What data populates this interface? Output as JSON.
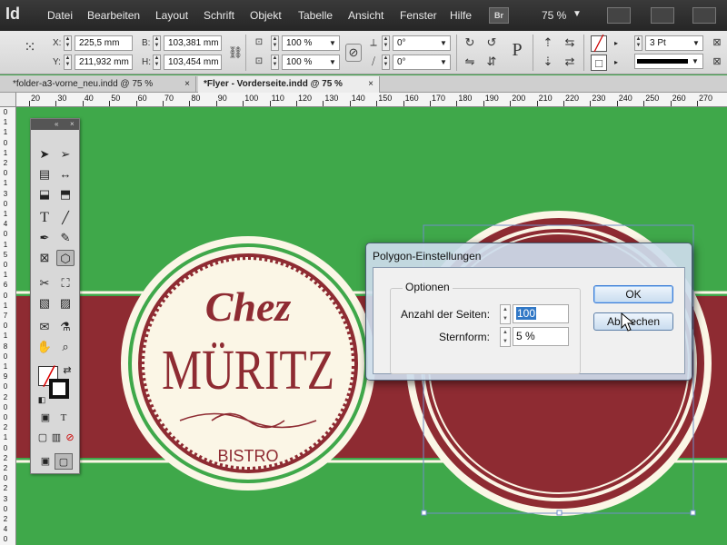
{
  "app": {
    "logo": "Id"
  },
  "menu": [
    "Datei",
    "Bearbeiten",
    "Layout",
    "Schrift",
    "Objekt",
    "Tabelle",
    "Ansicht",
    "Fenster",
    "Hilfe"
  ],
  "menu_extra": {
    "bridge": "Br",
    "zoom": "75 %"
  },
  "control": {
    "x_label": "X:",
    "x_value": "225,5 mm",
    "y_label": "Y:",
    "y_value": "211,932 mm",
    "b_label": "B:",
    "b_value": "103,381 mm",
    "h_label": "H:",
    "h_value": "103,454 mm",
    "scale_x": "100 %",
    "scale_y": "100 %",
    "rotate": "0°",
    "shear": "0°",
    "stroke_weight": "3 Pt"
  },
  "tabs": [
    {
      "label": "*folder-a3-vorne_neu.indd @ 75 %"
    },
    {
      "label": "*Flyer - Vorderseite.indd @ 75 %"
    }
  ],
  "ruler_h": [
    "20",
    "30",
    "40",
    "50",
    "60",
    "70",
    "80",
    "90",
    "100",
    "110",
    "120",
    "130",
    "140",
    "150",
    "160",
    "170",
    "180",
    "190",
    "200",
    "210",
    "220",
    "230",
    "240",
    "250",
    "260",
    "270"
  ],
  "ruler_v": [
    "0",
    "1",
    "1",
    "0",
    "1",
    "2",
    "0",
    "1",
    "3",
    "0",
    "1",
    "4",
    "0",
    "1",
    "5",
    "0",
    "1",
    "6",
    "0",
    "1",
    "7",
    "0",
    "1",
    "8",
    "0",
    "1",
    "9",
    "0",
    "2",
    "0",
    "0",
    "2",
    "1",
    "0",
    "2",
    "2",
    "0",
    "2",
    "3",
    "0",
    "2",
    "4",
    "0"
  ],
  "logo": {
    "line1": "Chez",
    "line2": "MÜRITZ",
    "line3": "BISTRO"
  },
  "colors": {
    "green": "#3fa84a",
    "burgundy": "#8e2b32",
    "cream": "#fbf6e6"
  },
  "dialog": {
    "title": "Polygon-Einstellungen",
    "group_label": "Optionen",
    "sides_label": "Anzahl der Seiten:",
    "sides_value": "100",
    "star_label": "Sternform:",
    "star_value": "5 %",
    "ok_label": "OK",
    "cancel_label": "Abbrechen"
  }
}
